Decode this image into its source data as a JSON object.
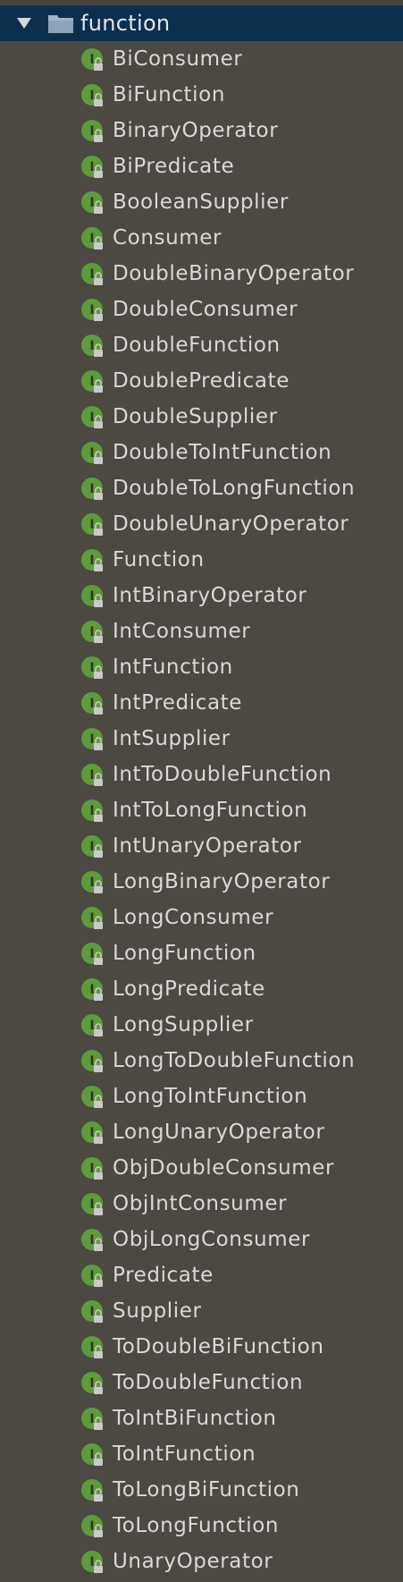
{
  "tree": {
    "folder": {
      "label": "function",
      "toggle_icon": "triangle-down-icon",
      "icon": "folder-icon"
    },
    "item_icon": "interface-icon",
    "item_icon_letter": "I",
    "items": [
      "BiConsumer",
      "BiFunction",
      "BinaryOperator",
      "BiPredicate",
      "BooleanSupplier",
      "Consumer",
      "DoubleBinaryOperator",
      "DoubleConsumer",
      "DoubleFunction",
      "DoublePredicate",
      "DoubleSupplier",
      "DoubleToIntFunction",
      "DoubleToLongFunction",
      "DoubleUnaryOperator",
      "Function",
      "IntBinaryOperator",
      "IntConsumer",
      "IntFunction",
      "IntPredicate",
      "IntSupplier",
      "IntToDoubleFunction",
      "IntToLongFunction",
      "IntUnaryOperator",
      "LongBinaryOperator",
      "LongConsumer",
      "LongFunction",
      "LongPredicate",
      "LongSupplier",
      "LongToDoubleFunction",
      "LongToIntFunction",
      "LongUnaryOperator",
      "ObjDoubleConsumer",
      "ObjIntConsumer",
      "ObjLongConsumer",
      "Predicate",
      "Supplier",
      "ToDoubleBiFunction",
      "ToDoubleFunction",
      "ToIntBiFunction",
      "ToIntFunction",
      "ToLongBiFunction",
      "ToLongFunction",
      "UnaryOperator"
    ]
  },
  "colors": {
    "background": "#4b4942",
    "selected_row": "#0d2f4f",
    "text": "#d9d9d9",
    "interface_badge": "#5f9a3c",
    "folder": "#9fb3c6"
  }
}
